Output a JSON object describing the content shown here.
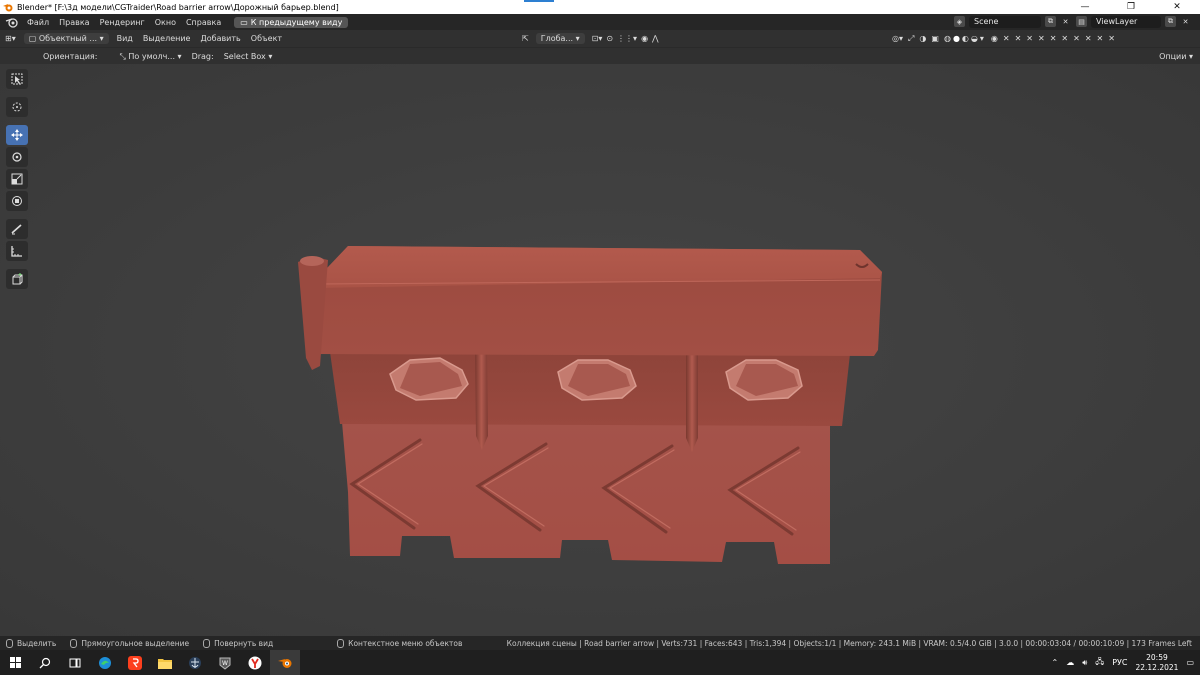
{
  "window": {
    "title": "Blender* [F:\\3д модели\\CGTraider\\Road barrier arrow\\Дорожный барьер.blend]",
    "controls": {
      "minimize": "—",
      "maximize": "❐",
      "close": "✕"
    },
    "accent_color": "#2d7fd1"
  },
  "menubar": {
    "items": [
      "Файл",
      "Правка",
      "Рендеринг",
      "Окно",
      "Справка"
    ],
    "back_button": "К предыдущему виду",
    "scene_label": "Scene",
    "viewlayer_label": "ViewLayer"
  },
  "header": {
    "mode": "Объектный ...",
    "menus": [
      "Вид",
      "Выделение",
      "Добавить",
      "Объект"
    ],
    "transform": "Глоба...",
    "right_label": "Опции"
  },
  "tool_settings": {
    "orientation_label": "Ориентация:",
    "orientation_value": "По умолч...",
    "drag_label": "Drag:",
    "drag_value": "Select Box"
  },
  "toolbar": {
    "tools": [
      "select-box",
      "cursor",
      "move",
      "rotate",
      "scale",
      "transform",
      "annotate",
      "measure",
      "add-cube"
    ],
    "active": "move",
    "active_color": "#4772b3"
  },
  "model": {
    "color": "#a24e43"
  },
  "statusbar": {
    "select": "Выделить",
    "box_select": "Прямоугольное выделение",
    "rotate_view": "Повернуть вид",
    "context_menu": "Контекстное меню объектов",
    "stats": "Коллекция сцены | Road barrier arrow | Verts:731 | Faces:643 | Tris:1,394 | Objects:1/1 | Memory: 243.1 MiB | VRAM: 0.5/4.0 GiB | 3.0.0 | 00:00:03:04 / 00:00:10:09 | 173 Frames Left"
  },
  "taskbar": {
    "lang": "РУС",
    "time": "20:59",
    "date": "22.12.2021",
    "apps": [
      "start",
      "search",
      "taskview",
      "edge",
      "yandex",
      "explorer",
      "wot",
      "wows",
      "yandex-browser",
      "blender"
    ]
  }
}
